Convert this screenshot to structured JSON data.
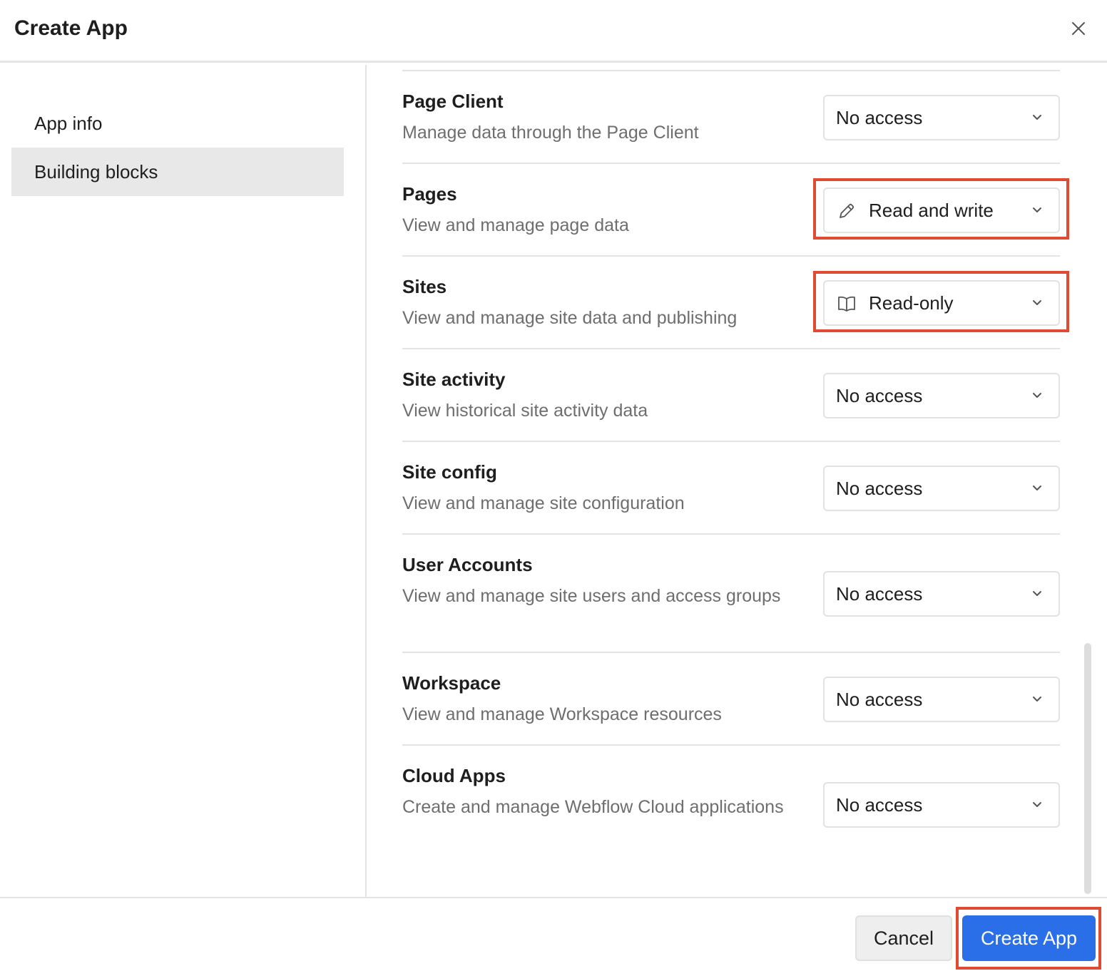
{
  "dialog": {
    "title": "Create App",
    "close_icon": "close-icon"
  },
  "sidebar": {
    "items": [
      {
        "label": "App info",
        "active": false
      },
      {
        "label": "Building blocks",
        "active": true
      }
    ]
  },
  "permissions": [
    {
      "title": "Page Client",
      "description": "Manage data through the Page Client",
      "value": "No access",
      "icon": null
    },
    {
      "title": "Pages",
      "description": "View and manage page data",
      "value": "Read and write",
      "icon": "pencil-icon",
      "highlighted": true
    },
    {
      "title": "Sites",
      "description": "View and manage site data and publishing",
      "value": "Read-only",
      "icon": "book-icon",
      "highlighted": true
    },
    {
      "title": "Site activity",
      "description": "View historical site activity data",
      "value": "No access",
      "icon": null
    },
    {
      "title": "Site config",
      "description": "View and manage site configuration",
      "value": "No access",
      "icon": null
    },
    {
      "title": "User Accounts",
      "description": "View and manage site users and access groups",
      "value": "No access",
      "icon": null
    },
    {
      "title": "Workspace",
      "description": "View and manage Workspace resources",
      "value": "No access",
      "icon": null
    },
    {
      "title": "Cloud Apps",
      "description": "Create and manage Webflow Cloud applications",
      "value": "No access",
      "icon": null
    }
  ],
  "footer": {
    "cancel_label": "Cancel",
    "create_label": "Create App",
    "create_highlighted": true
  },
  "colors": {
    "primary": "#2a6fe8",
    "highlight": "#e04a33",
    "muted_text": "#6e6e6e"
  }
}
